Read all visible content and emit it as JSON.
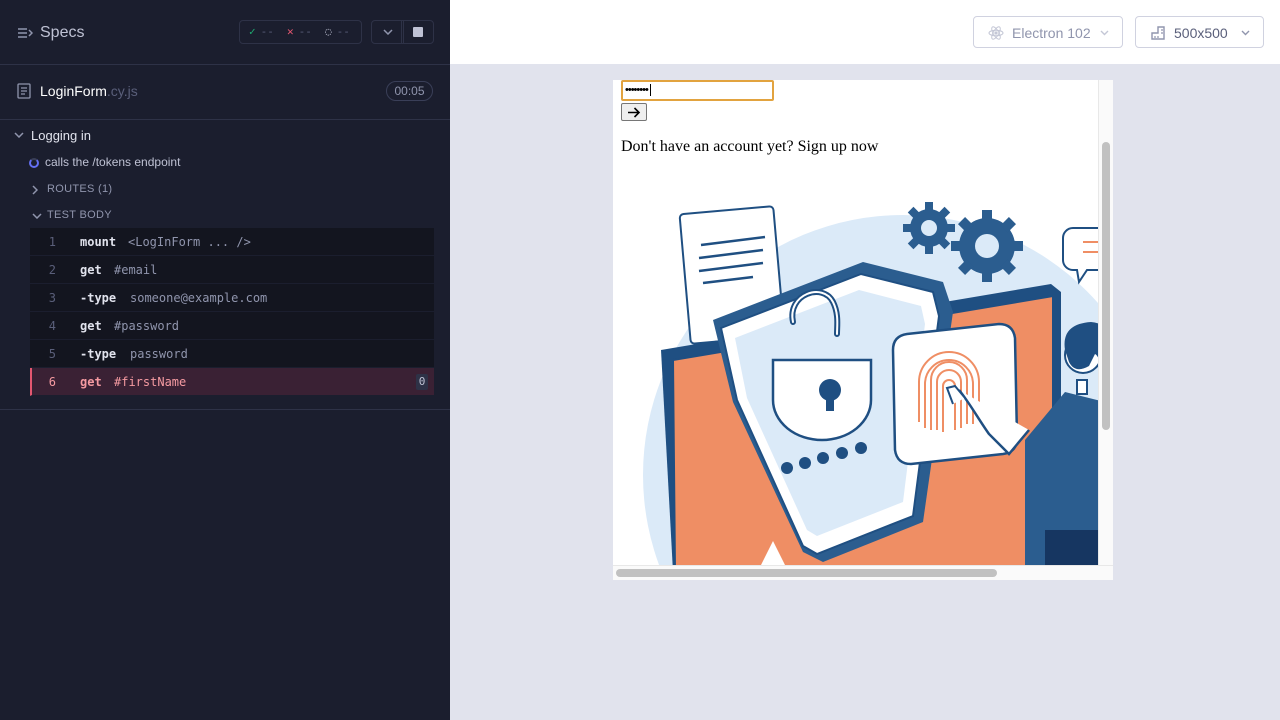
{
  "reporter": {
    "title": "Specs",
    "stats": {
      "passed": "--",
      "failed": "--",
      "pending": "--"
    },
    "file": {
      "name": "LoginForm",
      "ext": ".cy.js",
      "duration": "00:05"
    },
    "suite": "Logging in",
    "test": "calls the /tokens endpoint",
    "routes_label": "ROUTES (1)",
    "body_label": "TEST BODY",
    "commands": [
      {
        "num": "1",
        "name": "mount",
        "message": "<LogInForm ... />"
      },
      {
        "num": "2",
        "name": "get",
        "message": "#email"
      },
      {
        "num": "3",
        "name": "-type",
        "message": "someone@example.com"
      },
      {
        "num": "4",
        "name": "get",
        "message": "#password"
      },
      {
        "num": "5",
        "name": "-type",
        "message": "password"
      },
      {
        "num": "6",
        "name": "get",
        "message": "#firstName",
        "count": "0"
      }
    ]
  },
  "header": {
    "browser": "Electron 102",
    "viewport": "500x500"
  },
  "aut": {
    "password_value": "••••••••",
    "signup_text": "Don't have an account yet? Sign up now"
  },
  "colors": {
    "passed": "#1fa971",
    "failed": "#e45770",
    "accent": "#6470f3",
    "focus": "#e2a33f",
    "illustration_orange": "#ef8e64",
    "illustration_navy": "#1f4f82"
  }
}
